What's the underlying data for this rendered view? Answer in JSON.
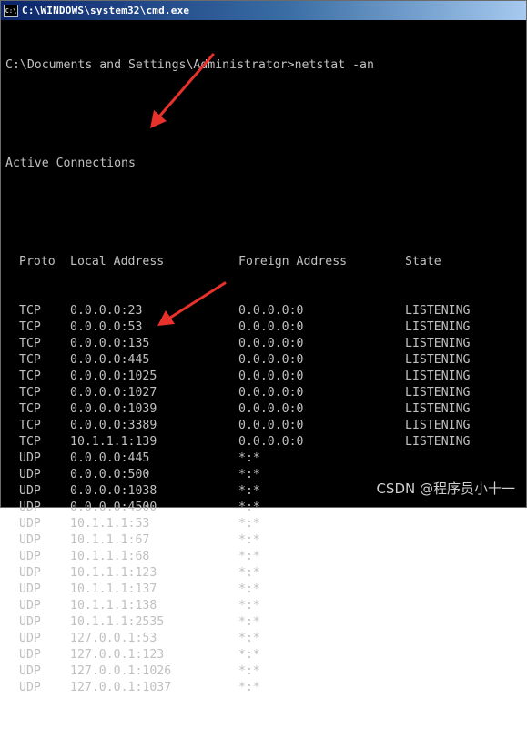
{
  "window": {
    "title": "C:\\WINDOWS\\system32\\cmd.exe",
    "icon": "cmd-icon",
    "icon_text": "C:\\"
  },
  "console": {
    "prompt": "C:\\Documents and Settings\\Administrator>netstat -an",
    "section_title": "Active Connections",
    "headers": {
      "proto": "Proto",
      "local": "Local Address",
      "foreign": "Foreign Address",
      "state": "State"
    },
    "rows": [
      {
        "proto": "TCP",
        "local": "0.0.0.0:23",
        "foreign": "0.0.0.0:0",
        "state": "LISTENING"
      },
      {
        "proto": "TCP",
        "local": "0.0.0.0:53",
        "foreign": "0.0.0.0:0",
        "state": "LISTENING"
      },
      {
        "proto": "TCP",
        "local": "0.0.0.0:135",
        "foreign": "0.0.0.0:0",
        "state": "LISTENING"
      },
      {
        "proto": "TCP",
        "local": "0.0.0.0:445",
        "foreign": "0.0.0.0:0",
        "state": "LISTENING"
      },
      {
        "proto": "TCP",
        "local": "0.0.0.0:1025",
        "foreign": "0.0.0.0:0",
        "state": "LISTENING"
      },
      {
        "proto": "TCP",
        "local": "0.0.0.0:1027",
        "foreign": "0.0.0.0:0",
        "state": "LISTENING"
      },
      {
        "proto": "TCP",
        "local": "0.0.0.0:1039",
        "foreign": "0.0.0.0:0",
        "state": "LISTENING"
      },
      {
        "proto": "TCP",
        "local": "0.0.0.0:3389",
        "foreign": "0.0.0.0:0",
        "state": "LISTENING"
      },
      {
        "proto": "TCP",
        "local": "10.1.1.1:139",
        "foreign": "0.0.0.0:0",
        "state": "LISTENING"
      },
      {
        "proto": "UDP",
        "local": "0.0.0.0:445",
        "foreign": "*:*",
        "state": ""
      },
      {
        "proto": "UDP",
        "local": "0.0.0.0:500",
        "foreign": "*:*",
        "state": ""
      },
      {
        "proto": "UDP",
        "local": "0.0.0.0:1038",
        "foreign": "*:*",
        "state": ""
      },
      {
        "proto": "UDP",
        "local": "0.0.0.0:4500",
        "foreign": "*:*",
        "state": ""
      },
      {
        "proto": "UDP",
        "local": "10.1.1.1:53",
        "foreign": "*:*",
        "state": ""
      },
      {
        "proto": "UDP",
        "local": "10.1.1.1:67",
        "foreign": "*:*",
        "state": ""
      },
      {
        "proto": "UDP",
        "local": "10.1.1.1:68",
        "foreign": "*:*",
        "state": ""
      },
      {
        "proto": "UDP",
        "local": "10.1.1.1:123",
        "foreign": "*:*",
        "state": ""
      },
      {
        "proto": "UDP",
        "local": "10.1.1.1:137",
        "foreign": "*:*",
        "state": ""
      },
      {
        "proto": "UDP",
        "local": "10.1.1.1:138",
        "foreign": "*:*",
        "state": ""
      },
      {
        "proto": "UDP",
        "local": "10.1.1.1:2535",
        "foreign": "*:*",
        "state": ""
      },
      {
        "proto": "UDP",
        "local": "127.0.0.1:53",
        "foreign": "*:*",
        "state": ""
      },
      {
        "proto": "UDP",
        "local": "127.0.0.1:123",
        "foreign": "*:*",
        "state": ""
      },
      {
        "proto": "UDP",
        "local": "127.0.0.1:1026",
        "foreign": "*:*",
        "state": ""
      },
      {
        "proto": "UDP",
        "local": "127.0.0.1:1037",
        "foreign": "*:*",
        "state": ""
      }
    ]
  },
  "annotations": {
    "arrow_color": "#e8312a",
    "arrow_icons": [
      "red-arrow-icon",
      "red-arrow-icon"
    ]
  },
  "watermark": "CSDN @程序员小十一",
  "colors": {
    "console_bg": "#000000",
    "console_text": "#c0c0c0",
    "titlebar_start": "#0a246a",
    "titlebar_end": "#a6caf0"
  }
}
